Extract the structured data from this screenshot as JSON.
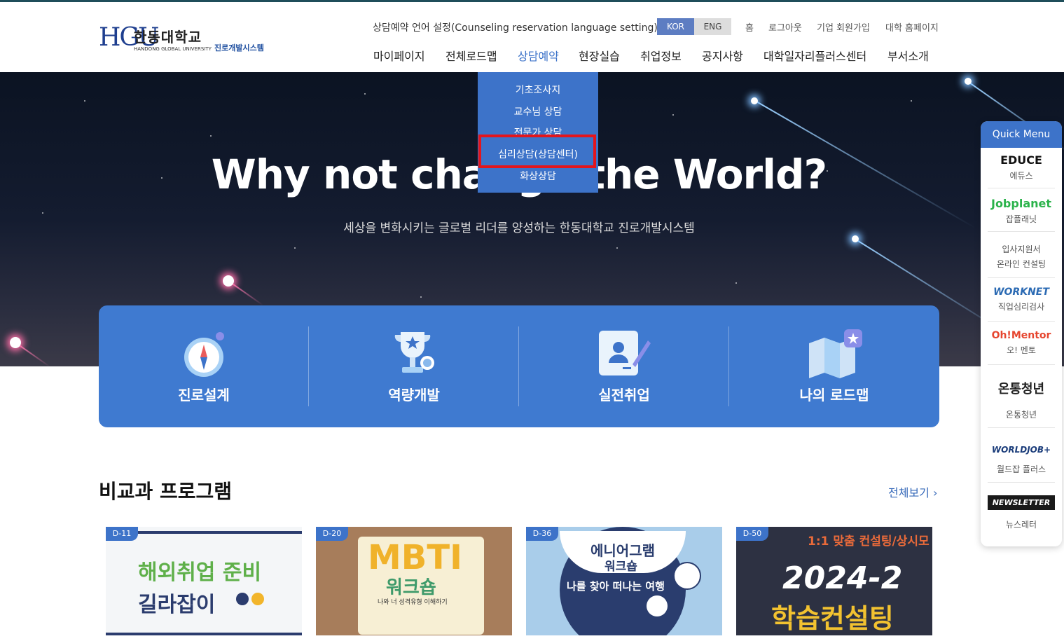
{
  "header": {
    "logo": {
      "mark": "HGU",
      "name_ko": "한동대학교",
      "name_en": "HANDONG GLOBAL UNIVERSITY",
      "system": "진로개발시스템"
    },
    "lang_setting_label": "상담예약 언어 설정(Counseling reservation language setting)",
    "lang_kor": "KOR",
    "lang_eng": "ENG",
    "util_links": [
      "홈",
      "로그아웃",
      "기업 회원가입",
      "대학 홈페이지"
    ],
    "nav": [
      "마이페이지",
      "전체로드맵",
      "상담예약",
      "현장실습",
      "취업정보",
      "공지사항",
      "대학일자리플러스센터",
      "부서소개"
    ]
  },
  "dropdown": {
    "items": [
      "기초조사지",
      "교수님 상담",
      "전문가 상담",
      "심리상담(상담센터)",
      "화상상담"
    ]
  },
  "hero": {
    "title": "Why not change the World?",
    "subtitle": "세상을 변화시키는 글로벌 리더를 양성하는 한동대학교 진로개발시스템"
  },
  "main_menu": [
    "진로설계",
    "역량개발",
    "실전취업",
    "나의 로드맵"
  ],
  "programs": {
    "title": "비교과 프로그램",
    "more": "전체보기",
    "cards": [
      {
        "badge": "D-11",
        "line1": "해외취업 준비",
        "line2": "길라잡이"
      },
      {
        "badge": "D-20",
        "line1": "MBTI",
        "line2": "워크숍",
        "line3": "나와 너 성격유형 이해하기"
      },
      {
        "badge": "D-36",
        "line1": "에니어그램",
        "line2": "워크숍",
        "line3": "나를 찾아 떠나는 여행"
      },
      {
        "badge": "D-50",
        "line1": "1:1 맞춤 컨설팅/상시모",
        "line2": "2024-2",
        "line3": "학습컨설팅"
      }
    ]
  },
  "quick": {
    "title": "Quick Menu",
    "items": [
      {
        "logo": "EDUCE",
        "label": "에듀스"
      },
      {
        "logo": "Jobplanet",
        "label": "잡플래닛"
      },
      {
        "logo": "입사지원서",
        "label": "온라인 컨설팅"
      },
      {
        "logo": "WORKNET",
        "label": "직업심리검사"
      },
      {
        "logo": "Oh!Mentor",
        "label": "오! 멘토"
      },
      {
        "logo": "온통청년",
        "label": "온통청년"
      },
      {
        "logo": "WORLDJOB+",
        "label": "월드잡 플러스"
      },
      {
        "logo": "NEWSLETTER",
        "label": "뉴스레터"
      }
    ]
  },
  "colors": {
    "primary": "#3d73c9",
    "highlight": "#e4151c",
    "hero_bg": "#141c30"
  }
}
